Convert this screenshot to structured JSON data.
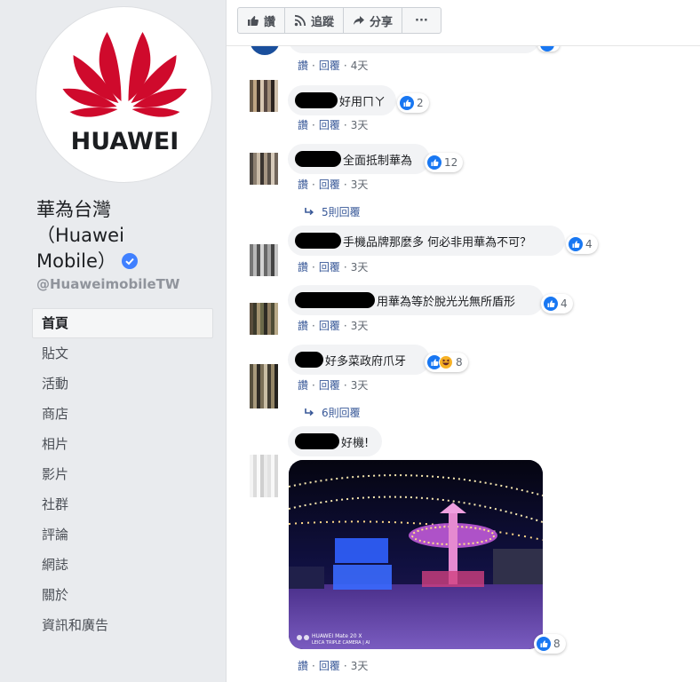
{
  "page": {
    "name_line1": "華為台灣",
    "name_line2": "（Huawei",
    "name_line3": "Mobile）",
    "handle": "@HuaweimobileTW",
    "logo_text": "HUAWEI",
    "brand_color": "#cf0a2c",
    "verified_color": "#4080ff"
  },
  "nav": [
    {
      "label": "首頁",
      "active": true
    },
    {
      "label": "貼文"
    },
    {
      "label": "活動"
    },
    {
      "label": "商店"
    },
    {
      "label": "相片"
    },
    {
      "label": "影片"
    },
    {
      "label": "社群"
    },
    {
      "label": "評論"
    },
    {
      "label": "網誌"
    },
    {
      "label": "關於"
    },
    {
      "label": "資訊和廣告"
    }
  ],
  "actions": {
    "like": "讚",
    "follow": "追蹤",
    "share": "分享",
    "more": "···"
  },
  "comments": [
    {
      "text": "",
      "likes": "",
      "like_label": "讚",
      "reply_label": "回覆",
      "time": "4天"
    },
    {
      "text": "好用ㄇㄚ",
      "likes": "2",
      "like_label": "讚",
      "reply_label": "回覆",
      "time": "3天"
    },
    {
      "text": "全面抵制華為",
      "likes": "12",
      "like_label": "讚",
      "reply_label": "回覆",
      "time": "3天",
      "replies": "5則回覆"
    },
    {
      "text": "手機品牌那麼多 何必非用華為不可？",
      "likes": "4",
      "like_label": "讚",
      "reply_label": "回覆",
      "time": "3天"
    },
    {
      "text": "用華為等於脫光光無所盾形",
      "likes": "4",
      "like_label": "讚",
      "reply_label": "回覆",
      "time": "3天"
    },
    {
      "text": "好多菜政府爪牙",
      "likes": "8",
      "like_label": "讚",
      "reply_label": "回覆",
      "time": "3天",
      "replies": "6則回覆"
    },
    {
      "text": "好機!",
      "likes": "8",
      "like_label": "讚",
      "reply_label": "回覆",
      "time": "3天"
    }
  ],
  "photo": {
    "watermark_line1": "HUAWEI Mate 20 X",
    "watermark_line2": "LEICA TRIPLE CAMERA | AI"
  },
  "colors": {
    "link": "#385898",
    "meta": "#606770",
    "like_blue": "#1877f2",
    "haha_yellow": "#f7b125"
  }
}
